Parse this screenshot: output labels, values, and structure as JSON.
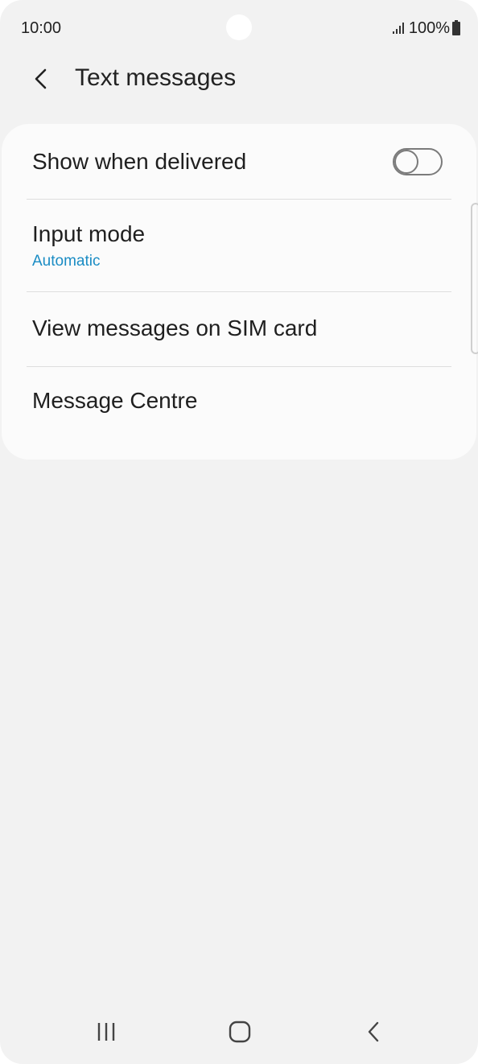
{
  "status_bar": {
    "time": "10:00",
    "battery": "100%",
    "icons": [
      "signal-icon",
      "battery-icon"
    ]
  },
  "app_bar": {
    "title": "Text messages",
    "back_icon": "chevron-left-icon"
  },
  "settings": {
    "show_when_delivered": {
      "label": "Show when delivered",
      "enabled": false
    },
    "input_mode": {
      "label": "Input mode",
      "value": "Automatic"
    },
    "view_sim_messages": {
      "label": "View messages on SIM card"
    },
    "message_centre": {
      "label": "Message Centre"
    }
  },
  "navigation": {
    "icons": [
      "recent-apps-icon",
      "home-icon",
      "back-icon"
    ]
  },
  "colors": {
    "background": "#f2f2f2",
    "card": "#fbfbfb",
    "accent": "#1a8cc4",
    "text": "#1f1f1f"
  }
}
